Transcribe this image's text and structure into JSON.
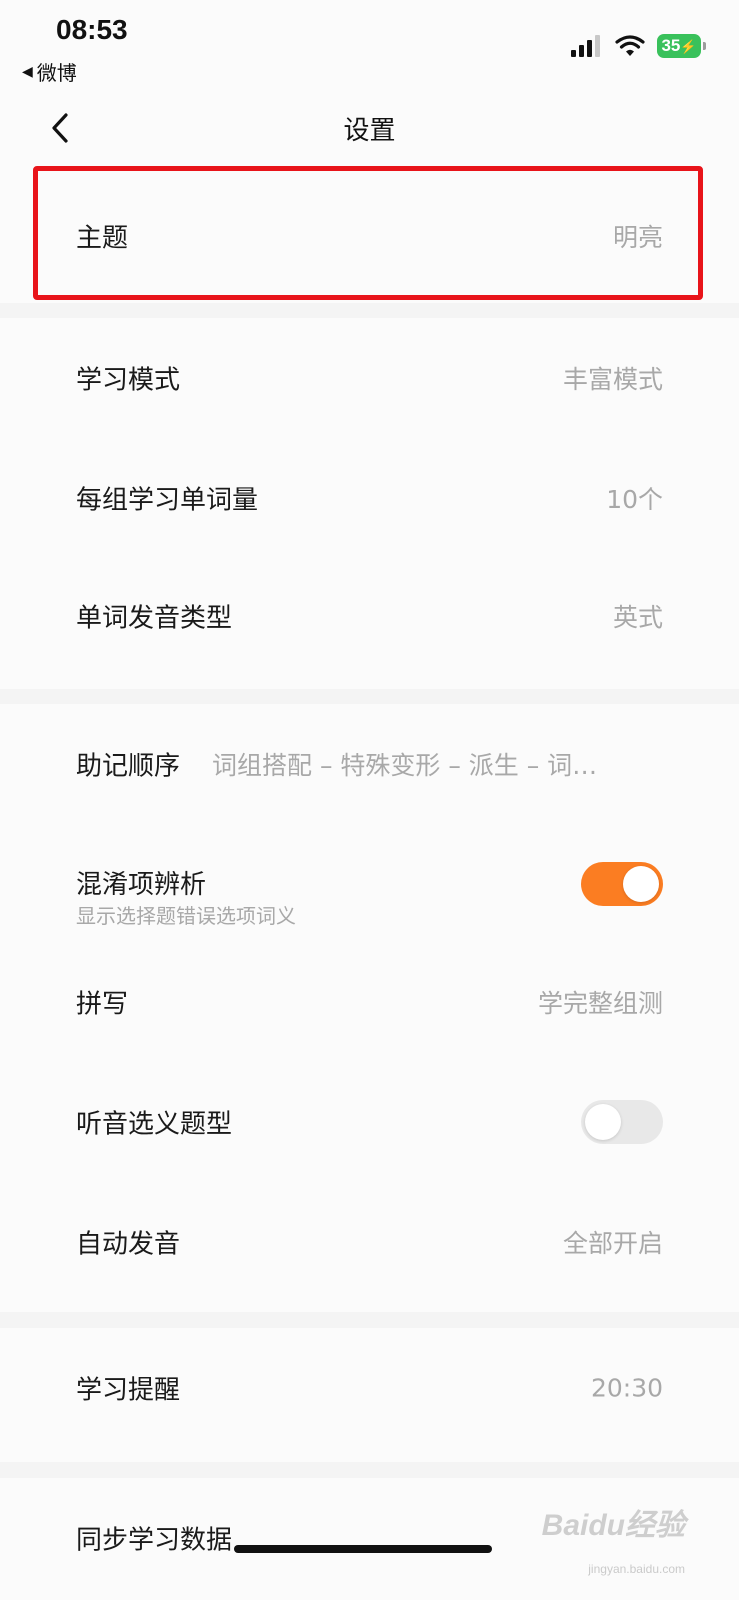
{
  "status_bar": {
    "time": "08:53",
    "back_app": "微博",
    "battery": "35",
    "icons": [
      "signal-icon",
      "wifi-icon",
      "battery-icon"
    ]
  },
  "nav": {
    "title": "设置",
    "back_icon": "chevron-left-icon"
  },
  "group_theme": {
    "theme": {
      "label": "主题",
      "value": "明亮"
    }
  },
  "group_learning": {
    "mode": {
      "label": "学习模式",
      "value": "丰富模式"
    },
    "words_per_group": {
      "label": "每组学习单词量",
      "value": "10个"
    },
    "pronunciation_type": {
      "label": "单词发音类型",
      "value": "英式"
    }
  },
  "group_practice": {
    "mnemonic_order": {
      "label": "助记顺序",
      "value": "词组搭配 – 特殊变形 – 派生 – 词…"
    },
    "confusion_analysis": {
      "label": "混淆项辨析",
      "sub": "显示选择题错误选项词义",
      "enabled": true
    },
    "spelling": {
      "label": "拼写",
      "value": "学完整组测"
    },
    "listen_choose": {
      "label": "听音选义题型",
      "enabled": false
    },
    "auto_pronounce": {
      "label": "自动发音",
      "value": "全部开启"
    }
  },
  "group_reminder": {
    "reminder": {
      "label": "学习提醒",
      "value": "20:30"
    }
  },
  "group_sync": {
    "sync": {
      "label": "同步学习数据"
    }
  },
  "watermark": {
    "brand": "Baidu经验",
    "url": "jingyan.baidu.com"
  },
  "colors": {
    "accent": "#fb7d22",
    "highlight": "#e8141a",
    "battery": "#39c15b"
  }
}
